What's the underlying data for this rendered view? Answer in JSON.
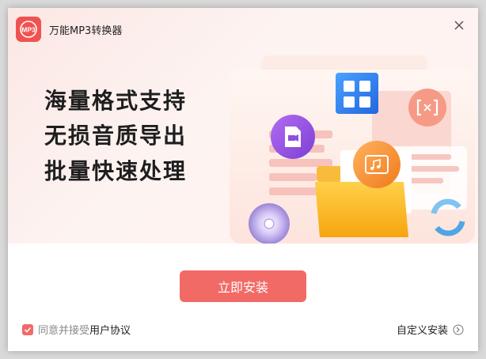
{
  "window": {
    "title": "万能MP3转换器",
    "icon_label": "MP3"
  },
  "hero": {
    "slogans": [
      "海量格式支持",
      "无损音质导出",
      "批量快速处理"
    ]
  },
  "actions": {
    "install_label": "立即安装",
    "agree_prefix": "同意并接受",
    "agreement_link": "用户协议",
    "agree_checked": true,
    "custom_install_label": "自定义安装"
  },
  "colors": {
    "accent": "#f26a66",
    "hero_bg": "#fbe7e4"
  },
  "icons": [
    "app-logo-icon",
    "close-icon",
    "checkmark-icon",
    "arrow-right-circle-icon",
    "video-file-icon",
    "grid-convert-icon",
    "split-icon",
    "music-folder-icon",
    "cd-disc-icon",
    "refresh-icon"
  ]
}
